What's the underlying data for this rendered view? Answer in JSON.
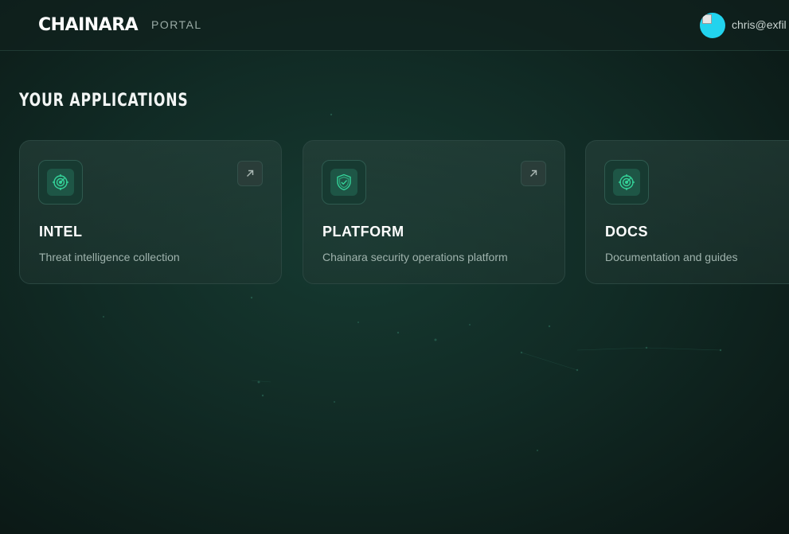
{
  "header": {
    "brand": "CHAINARA",
    "section": "PORTAL",
    "user_email": "chris@exfil",
    "avatar_color": "#22d3ee"
  },
  "main": {
    "title": "YOUR APPLICATIONS",
    "apps": [
      {
        "name": "INTEL",
        "description": "Threat intelligence collection",
        "icon": "radar-icon"
      },
      {
        "name": "PLATFORM",
        "description": "Chainara security operations platform",
        "icon": "shield-check-icon"
      },
      {
        "name": "DOCS",
        "description": "Documentation and guides",
        "icon": "radar-icon"
      }
    ]
  },
  "colors": {
    "accent": "#34d399",
    "background": "#112b25"
  }
}
